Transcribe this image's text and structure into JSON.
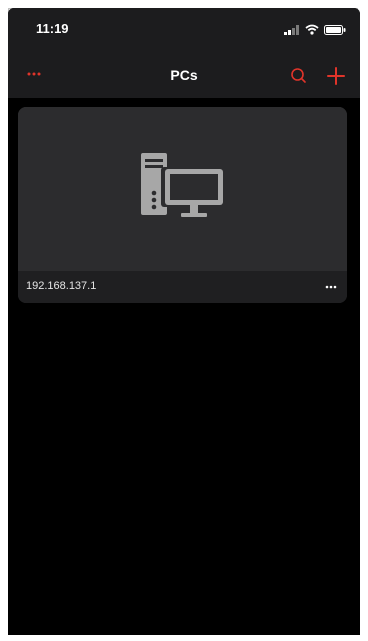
{
  "status_bar": {
    "time": "11:19",
    "icons": [
      "signal-icon",
      "wifi-icon",
      "battery-icon"
    ]
  },
  "nav": {
    "title": "PCs",
    "left_icon": "more-dots-icon",
    "right_icons": [
      "search-icon",
      "add-icon"
    ]
  },
  "pcs": [
    {
      "name": "192.168.137.1",
      "icon": "desktop-computer-icon",
      "menu_icon": "more-dots-icon"
    }
  ],
  "colors": {
    "accent": "#e0342a",
    "background": "#000000",
    "bar": "#1c1c1e",
    "card": "#2c2c2e",
    "icon_gray": "#a7a7a7"
  }
}
